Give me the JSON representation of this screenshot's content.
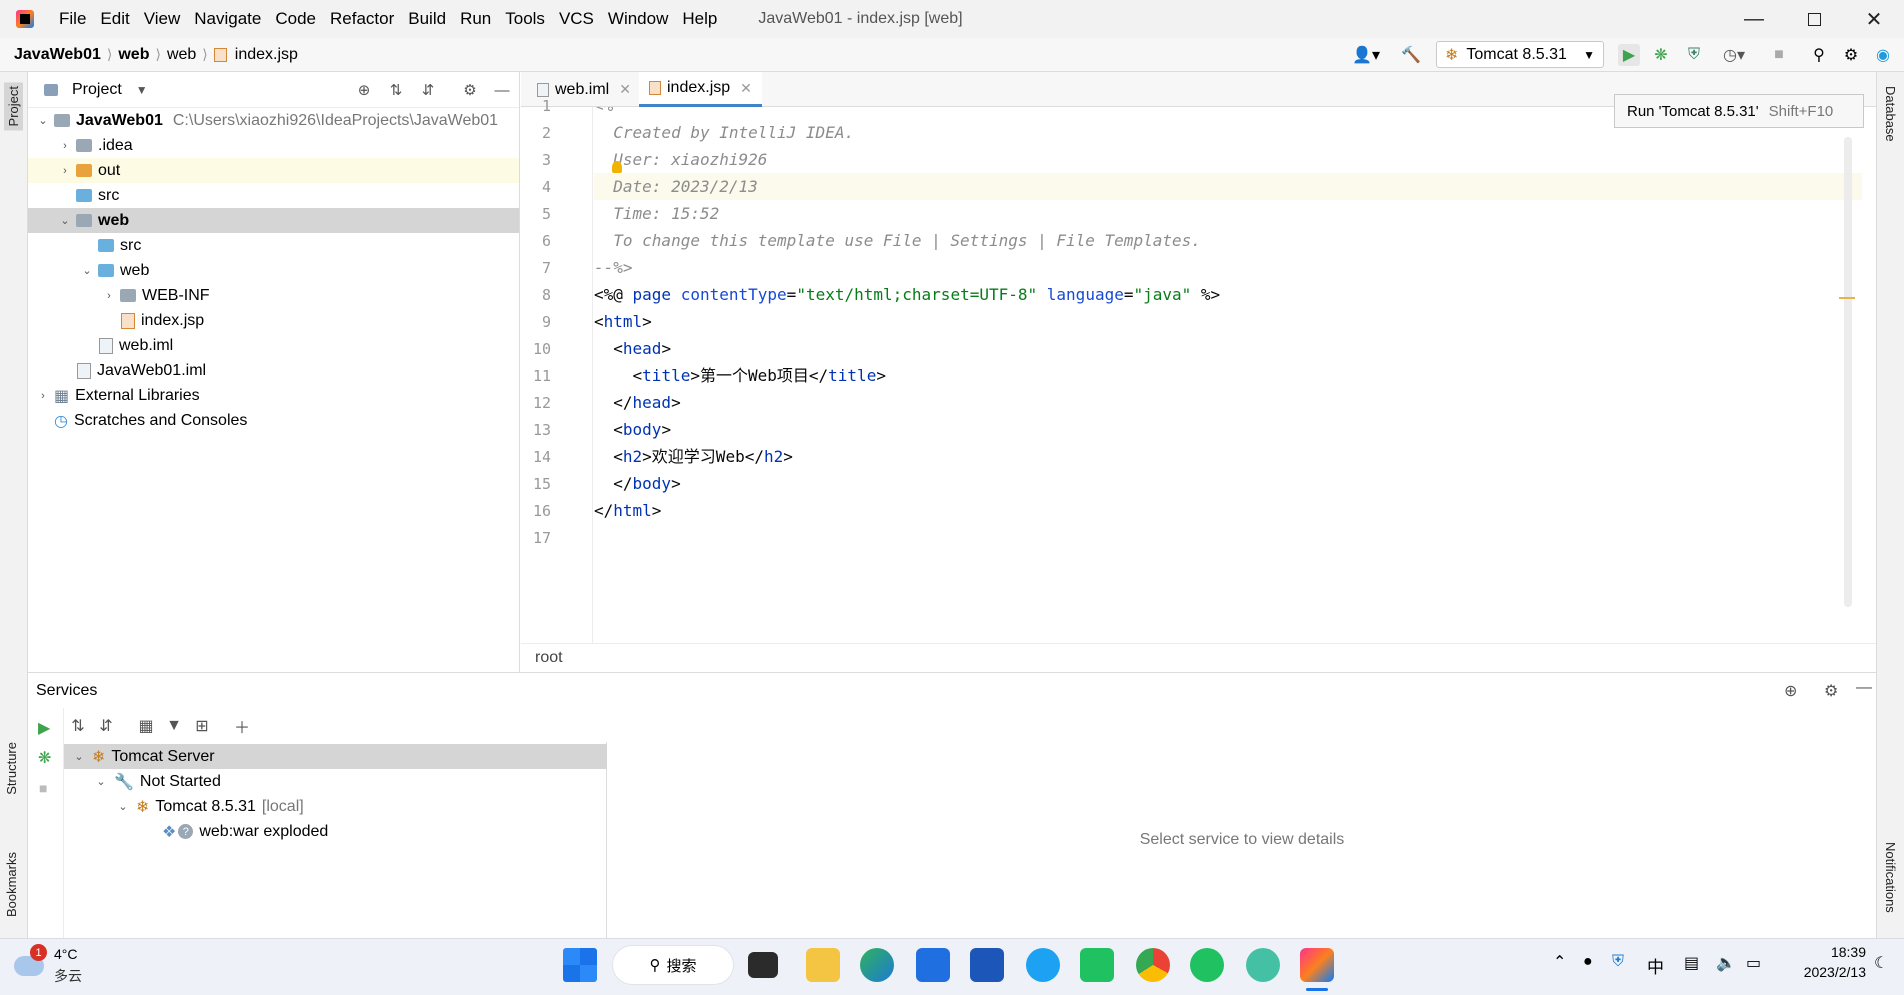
{
  "menu": {
    "items": [
      "File",
      "Edit",
      "View",
      "Navigate",
      "Code",
      "Refactor",
      "Build",
      "Run",
      "Tools",
      "VCS",
      "Window",
      "Help"
    ],
    "window_title": "JavaWeb01 - index.jsp [web]"
  },
  "navbar": {
    "crumbs": [
      "JavaWeb01",
      "web",
      "web",
      "index.jsp"
    ],
    "run_config": "Tomcat 8.5.31"
  },
  "tooltip": {
    "text": "Run 'Tomcat 8.5.31'",
    "shortcut": "Shift+F10"
  },
  "left_strip": {
    "project": "Project",
    "structure": "Structure",
    "bookmarks": "Bookmarks"
  },
  "right_strip": {
    "database": "Database",
    "notifications": "Notifications"
  },
  "project": {
    "title": "Project",
    "tree": [
      {
        "label": "JavaWeb01",
        "path": "C:\\Users\\xiaozhi926\\IdeaProjects\\JavaWeb01"
      },
      {
        "label": ".idea"
      },
      {
        "label": "out"
      },
      {
        "label": "src"
      },
      {
        "label": "web"
      },
      {
        "label": "src"
      },
      {
        "label": "web"
      },
      {
        "label": "WEB-INF"
      },
      {
        "label": "index.jsp"
      },
      {
        "label": "web.iml"
      },
      {
        "label": "JavaWeb01.iml"
      },
      {
        "label": "External Libraries"
      },
      {
        "label": "Scratches and Consoles"
      }
    ]
  },
  "editor": {
    "tabs": [
      "web.iml",
      "index.jsp"
    ],
    "line_numbers": [
      "1",
      "2",
      "3",
      "4",
      "5",
      "6",
      "7",
      "8",
      "9",
      "10",
      "11",
      "12",
      "13",
      "14",
      "15",
      "16",
      "17"
    ],
    "breadcrumb": "root"
  },
  "services": {
    "title": "Services",
    "tree": [
      {
        "label": "Tomcat Server"
      },
      {
        "label": "Not Started"
      },
      {
        "label": "Tomcat 8.5.31",
        "suffix": "[local]"
      },
      {
        "label": "web:war exploded"
      }
    ],
    "details_placeholder": "Select service to view details"
  },
  "taskbar": {
    "weather_temp": "4°C",
    "weather_desc": "多云",
    "weather_badge": "1",
    "search_label": "搜索",
    "ime": "中",
    "time": "18:39",
    "date": "2023/2/13"
  }
}
